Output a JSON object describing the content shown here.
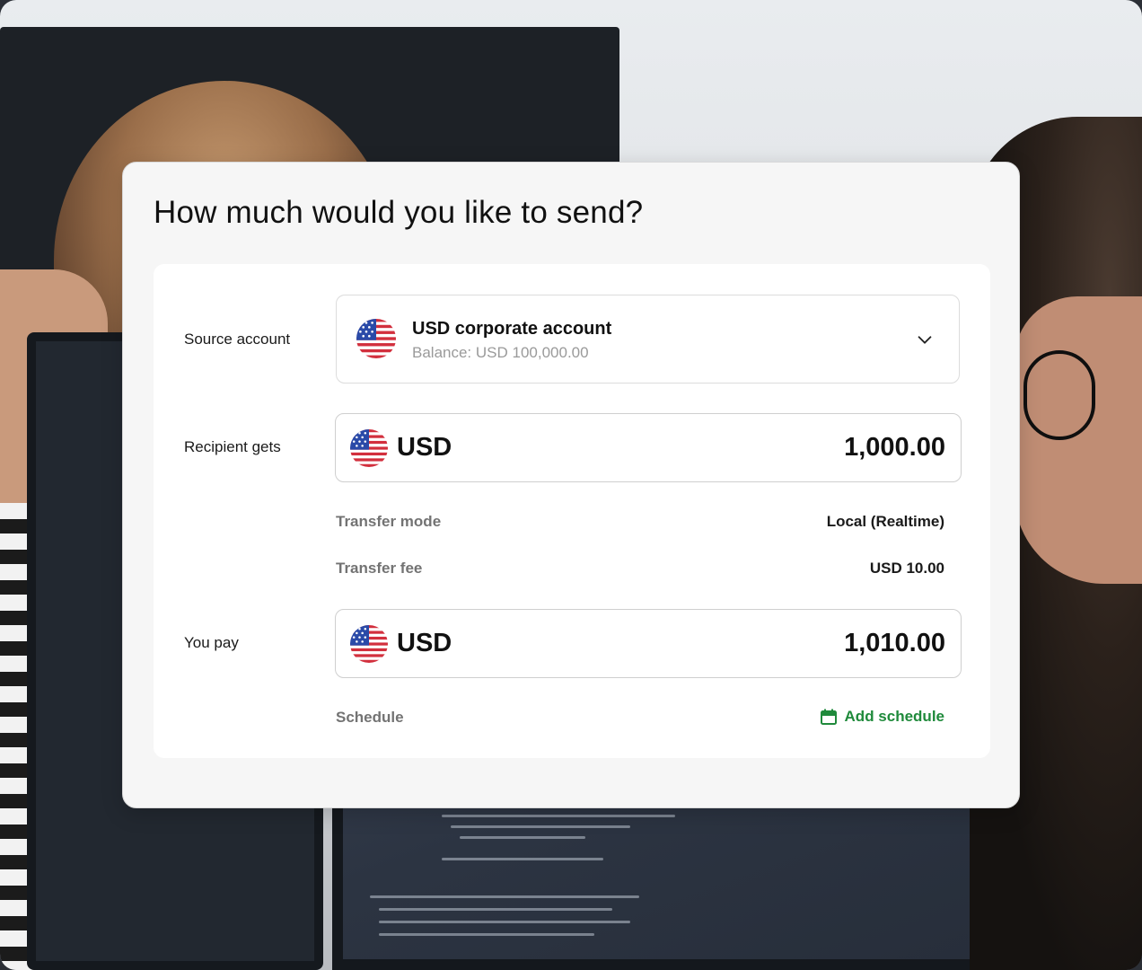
{
  "title": "How much would you like to send?",
  "source": {
    "label": "Source account",
    "account_name": "USD corporate account",
    "balance": "Balance: USD 100,000.00",
    "flag_icon": "us-flag-icon",
    "dropdown_icon": "chevron-down-icon"
  },
  "recipient": {
    "label": "Recipient gets",
    "currency": "USD",
    "amount": "1,000.00"
  },
  "details": {
    "transfer_mode_label": "Transfer mode",
    "transfer_mode_value": "Local (Realtime)",
    "transfer_fee_label": "Transfer fee",
    "transfer_fee_value": "USD 10.00"
  },
  "pay": {
    "label": "You pay",
    "currency": "USD",
    "amount": "1,010.00"
  },
  "schedule": {
    "label": "Schedule",
    "action": "Add schedule",
    "icon": "calendar-icon"
  },
  "colors": {
    "accent_green": "#1f8a3b",
    "muted_text": "#737373",
    "card_bg": "#f6f6f6"
  }
}
